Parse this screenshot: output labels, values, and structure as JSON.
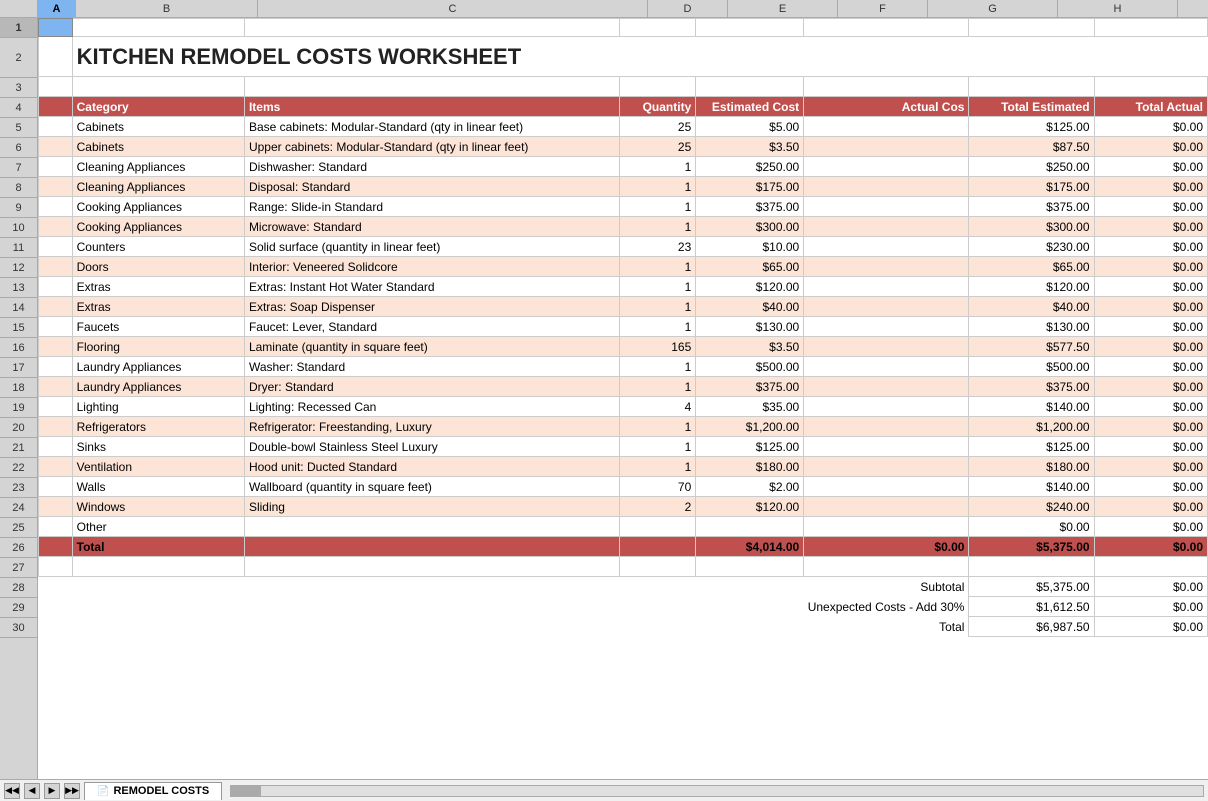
{
  "title": "KITCHEN REMODEL COSTS WORKSHEET",
  "sheet_name": "REMODEL COSTS",
  "columns": {
    "headers": [
      "A",
      "B",
      "C",
      "D",
      "E",
      "F",
      "G",
      "H"
    ],
    "col4_label": "Category",
    "col5_label": "Items",
    "col6_label": "Quantity",
    "col7_label": "Estimated Cost",
    "col8_label": "Actual Cos",
    "col9_label": "Total Estimated",
    "col10_label": "Total Actual"
  },
  "rows": [
    {
      "num": 5,
      "category": "Cabinets",
      "item": "Base cabinets: Modular-Standard (qty in linear feet)",
      "qty": "25",
      "est_cost": "$5.00",
      "act_cost": "",
      "total_est": "$125.00",
      "total_act": "$0.00"
    },
    {
      "num": 6,
      "category": "Cabinets",
      "item": "Upper cabinets: Modular-Standard (qty in linear feet)",
      "qty": "25",
      "est_cost": "$3.50",
      "act_cost": "",
      "total_est": "$87.50",
      "total_act": "$0.00"
    },
    {
      "num": 7,
      "category": "Cleaning Appliances",
      "item": "Dishwasher: Standard",
      "qty": "1",
      "est_cost": "$250.00",
      "act_cost": "",
      "total_est": "$250.00",
      "total_act": "$0.00"
    },
    {
      "num": 8,
      "category": "Cleaning Appliances",
      "item": "Disposal: Standard",
      "qty": "1",
      "est_cost": "$175.00",
      "act_cost": "",
      "total_est": "$175.00",
      "total_act": "$0.00"
    },
    {
      "num": 9,
      "category": "Cooking Appliances",
      "item": "Range: Slide-in Standard",
      "qty": "1",
      "est_cost": "$375.00",
      "act_cost": "",
      "total_est": "$375.00",
      "total_act": "$0.00"
    },
    {
      "num": 10,
      "category": "Cooking Appliances",
      "item": "Microwave: Standard",
      "qty": "1",
      "est_cost": "$300.00",
      "act_cost": "",
      "total_est": "$300.00",
      "total_act": "$0.00"
    },
    {
      "num": 11,
      "category": "Counters",
      "item": "Solid surface (quantity in linear feet)",
      "qty": "23",
      "est_cost": "$10.00",
      "act_cost": "",
      "total_est": "$230.00",
      "total_act": "$0.00"
    },
    {
      "num": 12,
      "category": "Doors",
      "item": "Interior: Veneered Solidcore",
      "qty": "1",
      "est_cost": "$65.00",
      "act_cost": "",
      "total_est": "$65.00",
      "total_act": "$0.00"
    },
    {
      "num": 13,
      "category": "Extras",
      "item": "Extras: Instant Hot Water Standard",
      "qty": "1",
      "est_cost": "$120.00",
      "act_cost": "",
      "total_est": "$120.00",
      "total_act": "$0.00"
    },
    {
      "num": 14,
      "category": "Extras",
      "item": "Extras: Soap Dispenser",
      "qty": "1",
      "est_cost": "$40.00",
      "act_cost": "",
      "total_est": "$40.00",
      "total_act": "$0.00"
    },
    {
      "num": 15,
      "category": "Faucets",
      "item": "Faucet: Lever, Standard",
      "qty": "1",
      "est_cost": "$130.00",
      "act_cost": "",
      "total_est": "$130.00",
      "total_act": "$0.00"
    },
    {
      "num": 16,
      "category": "Flooring",
      "item": "Laminate (quantity in square feet)",
      "qty": "165",
      "est_cost": "$3.50",
      "act_cost": "",
      "total_est": "$577.50",
      "total_act": "$0.00"
    },
    {
      "num": 17,
      "category": "Laundry Appliances",
      "item": "Washer: Standard",
      "qty": "1",
      "est_cost": "$500.00",
      "act_cost": "",
      "total_est": "$500.00",
      "total_act": "$0.00"
    },
    {
      "num": 18,
      "category": "Laundry Appliances",
      "item": "Dryer: Standard",
      "qty": "1",
      "est_cost": "$375.00",
      "act_cost": "",
      "total_est": "$375.00",
      "total_act": "$0.00"
    },
    {
      "num": 19,
      "category": "Lighting",
      "item": "Lighting: Recessed Can",
      "qty": "4",
      "est_cost": "$35.00",
      "act_cost": "",
      "total_est": "$140.00",
      "total_act": "$0.00"
    },
    {
      "num": 20,
      "category": "Refrigerators",
      "item": "Refrigerator: Freestanding, Luxury",
      "qty": "1",
      "est_cost": "$1,200.00",
      "act_cost": "",
      "total_est": "$1,200.00",
      "total_act": "$0.00"
    },
    {
      "num": 21,
      "category": "Sinks",
      "item": "Double-bowl Stainless Steel Luxury",
      "qty": "1",
      "est_cost": "$125.00",
      "act_cost": "",
      "total_est": "$125.00",
      "total_act": "$0.00"
    },
    {
      "num": 22,
      "category": "Ventilation",
      "item": "Hood unit: Ducted Standard",
      "qty": "1",
      "est_cost": "$180.00",
      "act_cost": "",
      "total_est": "$180.00",
      "total_act": "$0.00"
    },
    {
      "num": 23,
      "category": "Walls",
      "item": "Wallboard (quantity in square feet)",
      "qty": "70",
      "est_cost": "$2.00",
      "act_cost": "",
      "total_est": "$140.00",
      "total_act": "$0.00"
    },
    {
      "num": 24,
      "category": "Windows",
      "item": "Sliding",
      "qty": "2",
      "est_cost": "$120.00",
      "act_cost": "",
      "total_est": "$240.00",
      "total_act": "$0.00"
    },
    {
      "num": 25,
      "category": "Other",
      "item": "",
      "qty": "",
      "est_cost": "",
      "act_cost": "",
      "total_est": "$0.00",
      "total_act": "$0.00"
    }
  ],
  "total_row": {
    "num": 26,
    "label": "Total",
    "total_est_cost": "$4,014.00",
    "total_act_cost": "$0.00",
    "grand_total_est": "$5,375.00",
    "grand_total_act": "$0.00"
  },
  "summary": {
    "subtotal_label": "Subtotal",
    "subtotal_est": "$5,375.00",
    "subtotal_act": "$0.00",
    "unexpected_label": "Unexpected Costs - Add 30%",
    "unexpected_est": "$1,612.50",
    "unexpected_act": "$0.00",
    "total_label": "Total",
    "total_est": "$6,987.50",
    "total_act": "$0.00"
  }
}
